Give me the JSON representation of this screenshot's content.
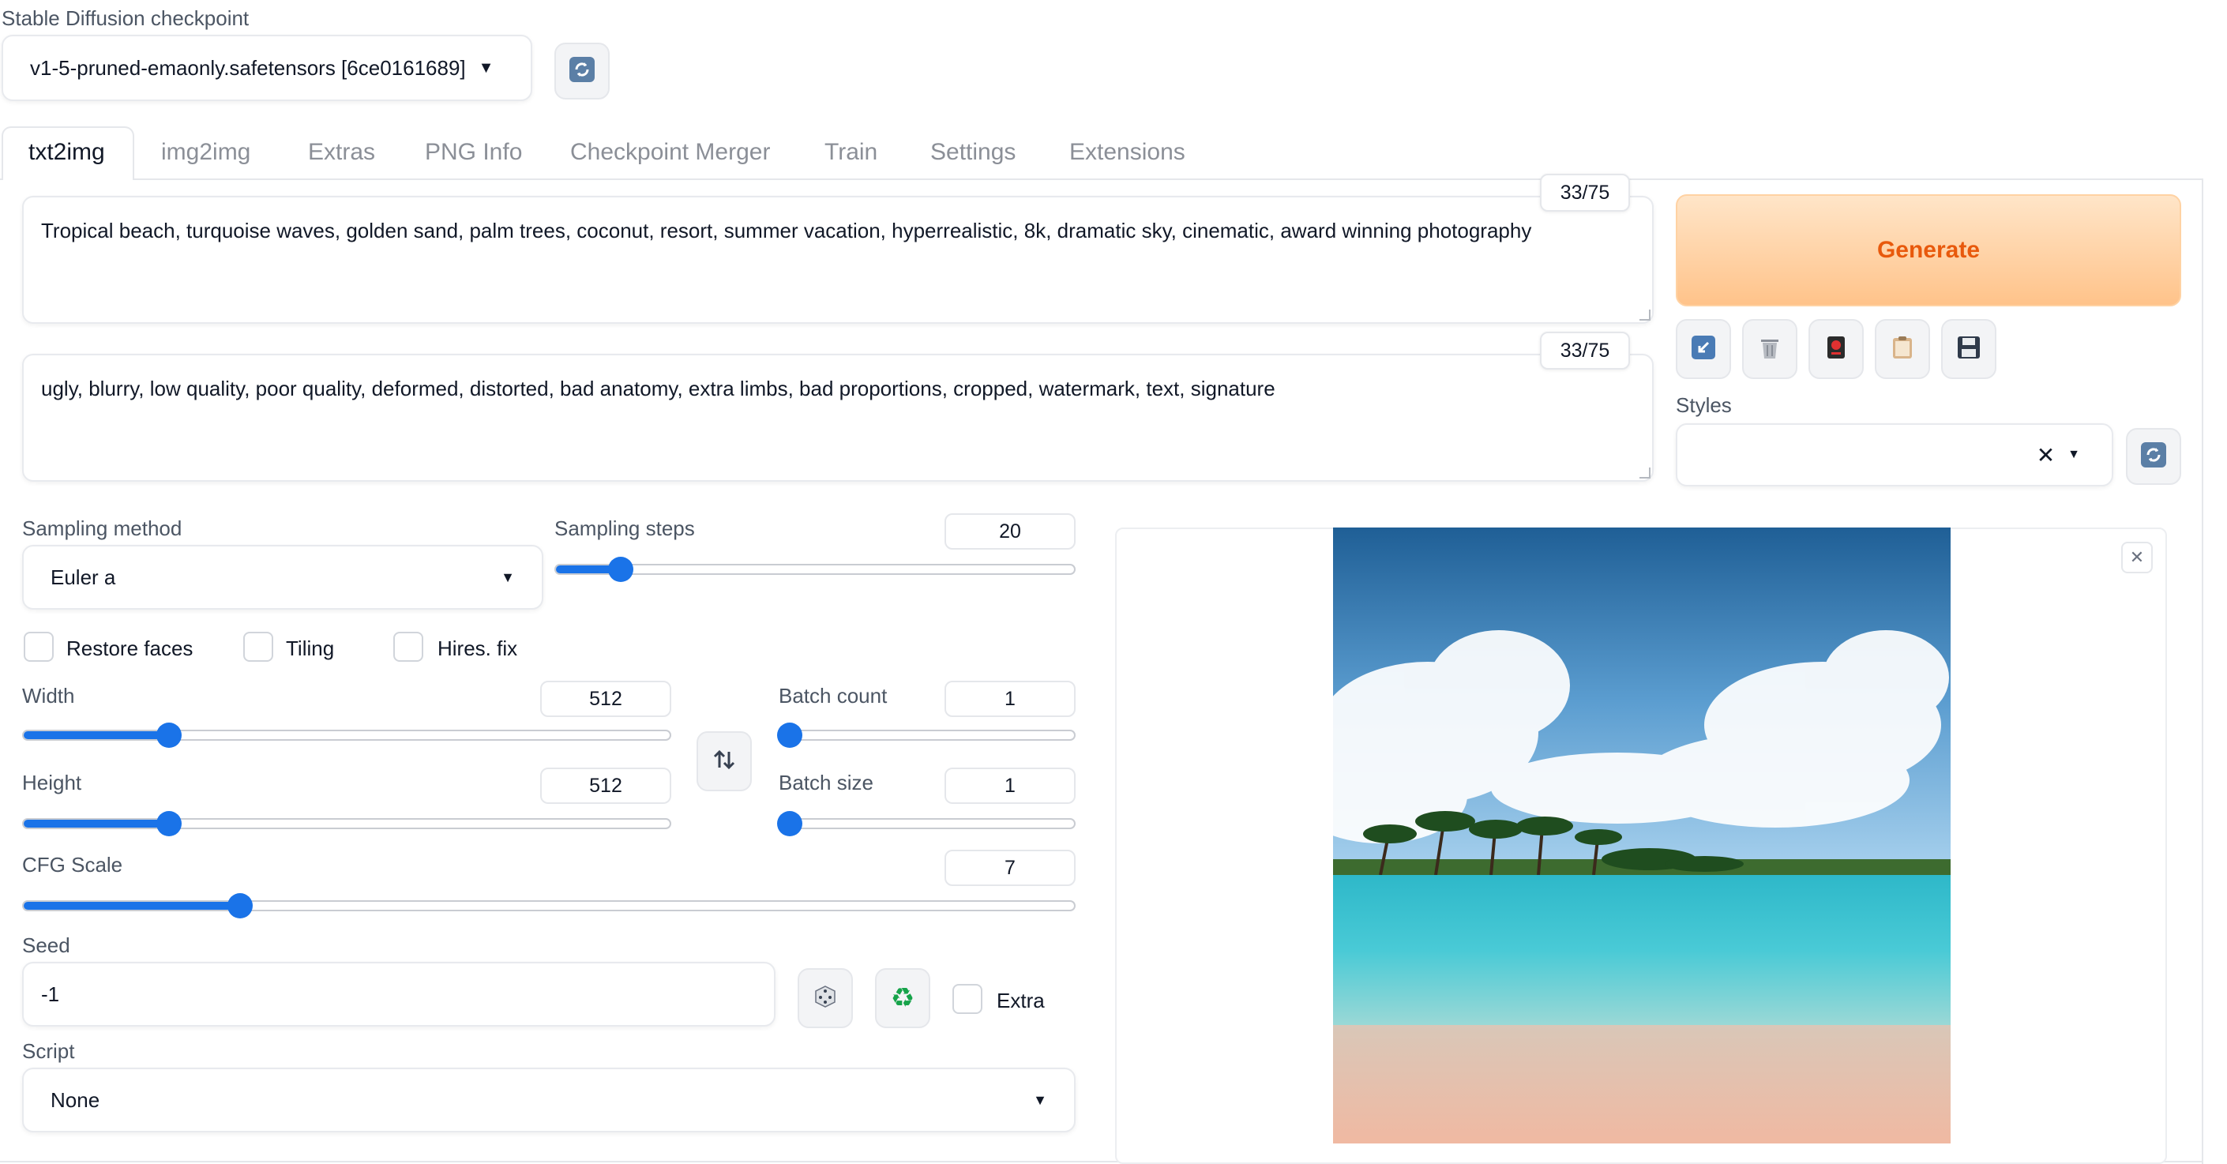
{
  "checkpoint": {
    "label": "Stable Diffusion checkpoint",
    "value": "v1-5-pruned-emaonly.safetensors [6ce0161689]"
  },
  "tabs": [
    "txt2img",
    "img2img",
    "Extras",
    "PNG Info",
    "Checkpoint Merger",
    "Train",
    "Settings",
    "Extensions"
  ],
  "prompt": {
    "text": "Tropical beach, turquoise waves, golden sand, palm trees, coconut, resort, summer vacation, hyperrealistic, 8k, dramatic sky, cinematic, award winning photography",
    "token_count": "33/75"
  },
  "negative_prompt": {
    "text": "ugly, blurry, low quality, poor quality, deformed, distorted, bad anatomy, extra limbs, bad proportions, cropped, watermark, text, signature",
    "token_count": "33/75"
  },
  "generate": {
    "label": "Generate"
  },
  "styles": {
    "label": "Styles",
    "value": ""
  },
  "sampling_method": {
    "label": "Sampling method",
    "value": "Euler a"
  },
  "sampling_steps": {
    "label": "Sampling steps",
    "value": "20",
    "min": 1,
    "max": 150
  },
  "checkboxes": {
    "restore_faces": "Restore faces",
    "tiling": "Tiling",
    "hires_fix": "Hires. fix"
  },
  "width": {
    "label": "Width",
    "value": "512",
    "min": 64,
    "max": 2048
  },
  "height": {
    "label": "Height",
    "value": "512",
    "min": 64,
    "max": 2048
  },
  "batch_count": {
    "label": "Batch count",
    "value": "1",
    "min": 1,
    "max": 100
  },
  "batch_size": {
    "label": "Batch size",
    "value": "1",
    "min": 1,
    "max": 8
  },
  "cfg_scale": {
    "label": "CFG Scale",
    "value": "7",
    "min": 1,
    "max": 30
  },
  "seed": {
    "label": "Seed",
    "value": "-1",
    "extra_label": "Extra"
  },
  "script": {
    "label": "Script",
    "value": "None"
  },
  "icons": {
    "refresh": "refresh-icon",
    "paste": "arrow-paste-icon",
    "trash": "trash-icon",
    "card": "red-card-icon",
    "clipboard": "clipboard-icon",
    "save": "floppy-disk-icon",
    "swap": "swap-arrows-icon",
    "dice": "dice-icon",
    "recycle": "recycle-icon"
  },
  "colors": {
    "accent": "#1a73e8",
    "generate_text": "#e8590c",
    "generate_bg_start": "#ffe3c4",
    "generate_bg_end": "#ffc58d"
  }
}
